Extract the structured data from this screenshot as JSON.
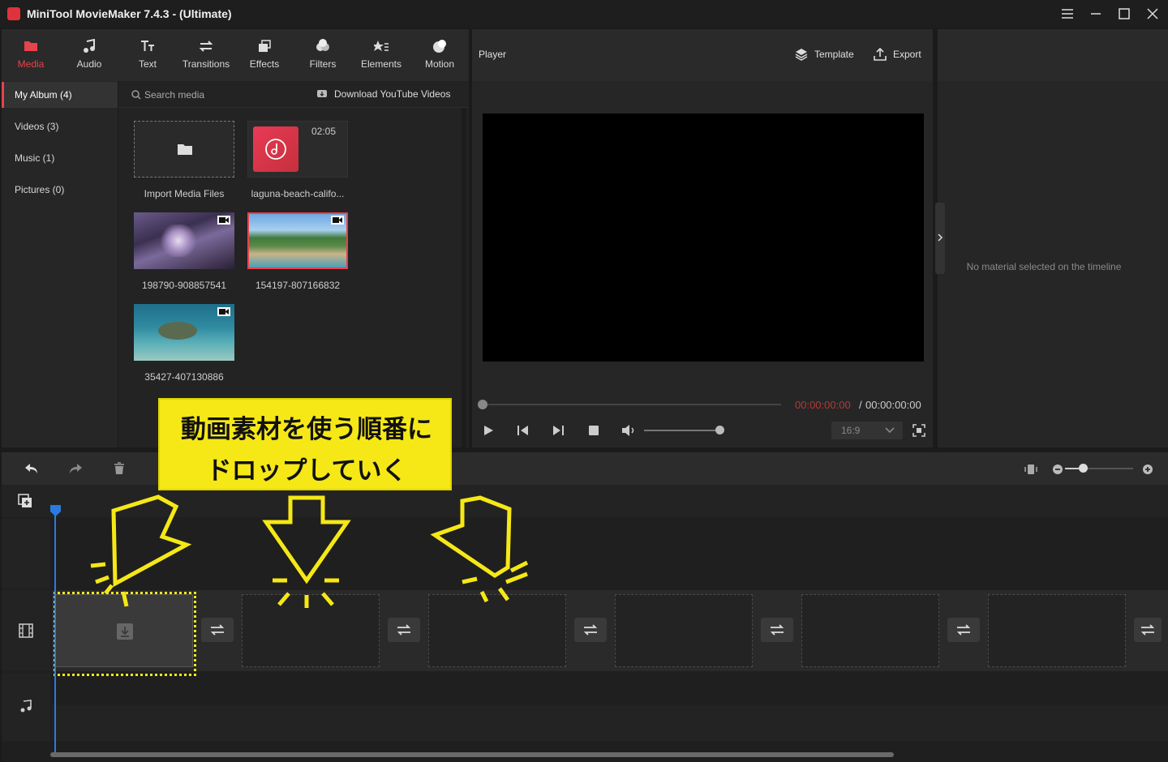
{
  "window": {
    "title": "MiniTool MovieMaker 7.4.3 - (Ultimate)"
  },
  "toolbar": {
    "tabs": [
      {
        "label": "Media",
        "icon": "media-folder-icon",
        "active": true
      },
      {
        "label": "Audio",
        "icon": "music-note-icon"
      },
      {
        "label": "Text",
        "icon": "text-icon"
      },
      {
        "label": "Transitions",
        "icon": "transition-arrows-icon"
      },
      {
        "label": "Effects",
        "icon": "effects-icon"
      },
      {
        "label": "Filters",
        "icon": "filters-icon"
      },
      {
        "label": "Elements",
        "icon": "elements-icon"
      },
      {
        "label": "Motion",
        "icon": "motion-icon"
      }
    ],
    "accent": "#e8424c"
  },
  "sidebar": {
    "items": [
      {
        "label": "My Album (4)",
        "active": true
      },
      {
        "label": "Videos (3)"
      },
      {
        "label": "Music (1)"
      },
      {
        "label": "Pictures (0)"
      }
    ]
  },
  "media": {
    "search_placeholder": "Search media",
    "download_label": "Download YouTube Videos",
    "items": [
      {
        "caption": "Import Media Files",
        "kind": "import"
      },
      {
        "caption": "laguna-beach-califo...",
        "kind": "music",
        "duration": "02:05"
      },
      {
        "caption": "198790-908857541",
        "kind": "video"
      },
      {
        "caption": "154197-807166832",
        "kind": "video",
        "selected": true
      },
      {
        "caption": "35427-407130886",
        "kind": "video"
      }
    ]
  },
  "player": {
    "title": "Player",
    "template_label": "Template",
    "export_label": "Export",
    "current_time": "00:00:00:00",
    "separator": "/",
    "total_time": "00:00:00:00",
    "aspect": "16:9"
  },
  "properties": {
    "empty_text": "No material selected on the timeline"
  },
  "annotation": {
    "line1": "動画素材を使う順番に",
    "line2": "ドロップしていく",
    "color": "#f5e816"
  }
}
